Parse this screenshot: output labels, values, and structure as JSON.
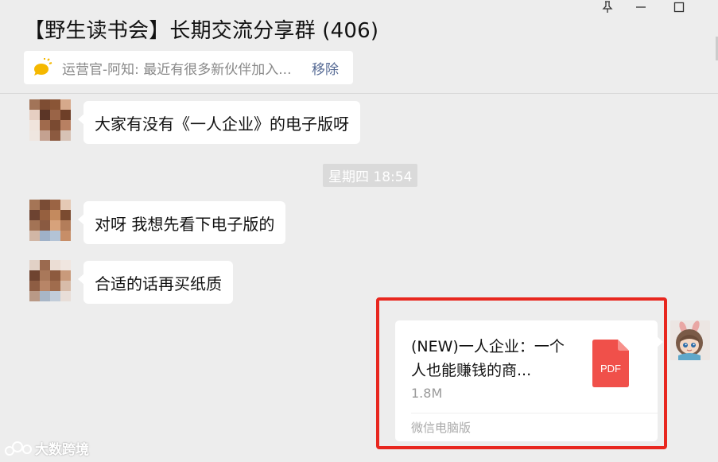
{
  "window": {
    "title": "【野生读书会】长期交流分享群 (406)"
  },
  "announcement": {
    "text": "运营官-阿知: 最近有很多新伙伴加入...",
    "remove_label": "移除"
  },
  "messages": [
    {
      "text": "大家有没有《一人企业》的电子版呀"
    },
    {
      "text": "对呀 我想先看下电子版的"
    },
    {
      "text": "合适的话再买纸质"
    }
  ],
  "timestamp": "星期四 18:54",
  "file_message": {
    "name": "(NEW)一人企业：一个人也能赚钱的商...",
    "size": "1.8M",
    "type_label": "PDF",
    "source": "微信电脑版"
  },
  "watermark": {
    "text": "大数跨境"
  },
  "colors": {
    "background": "#ededed",
    "bubble": "#ffffff",
    "link": "#576b95",
    "highlight": "#e8271f",
    "pdf": "#f0504a"
  }
}
